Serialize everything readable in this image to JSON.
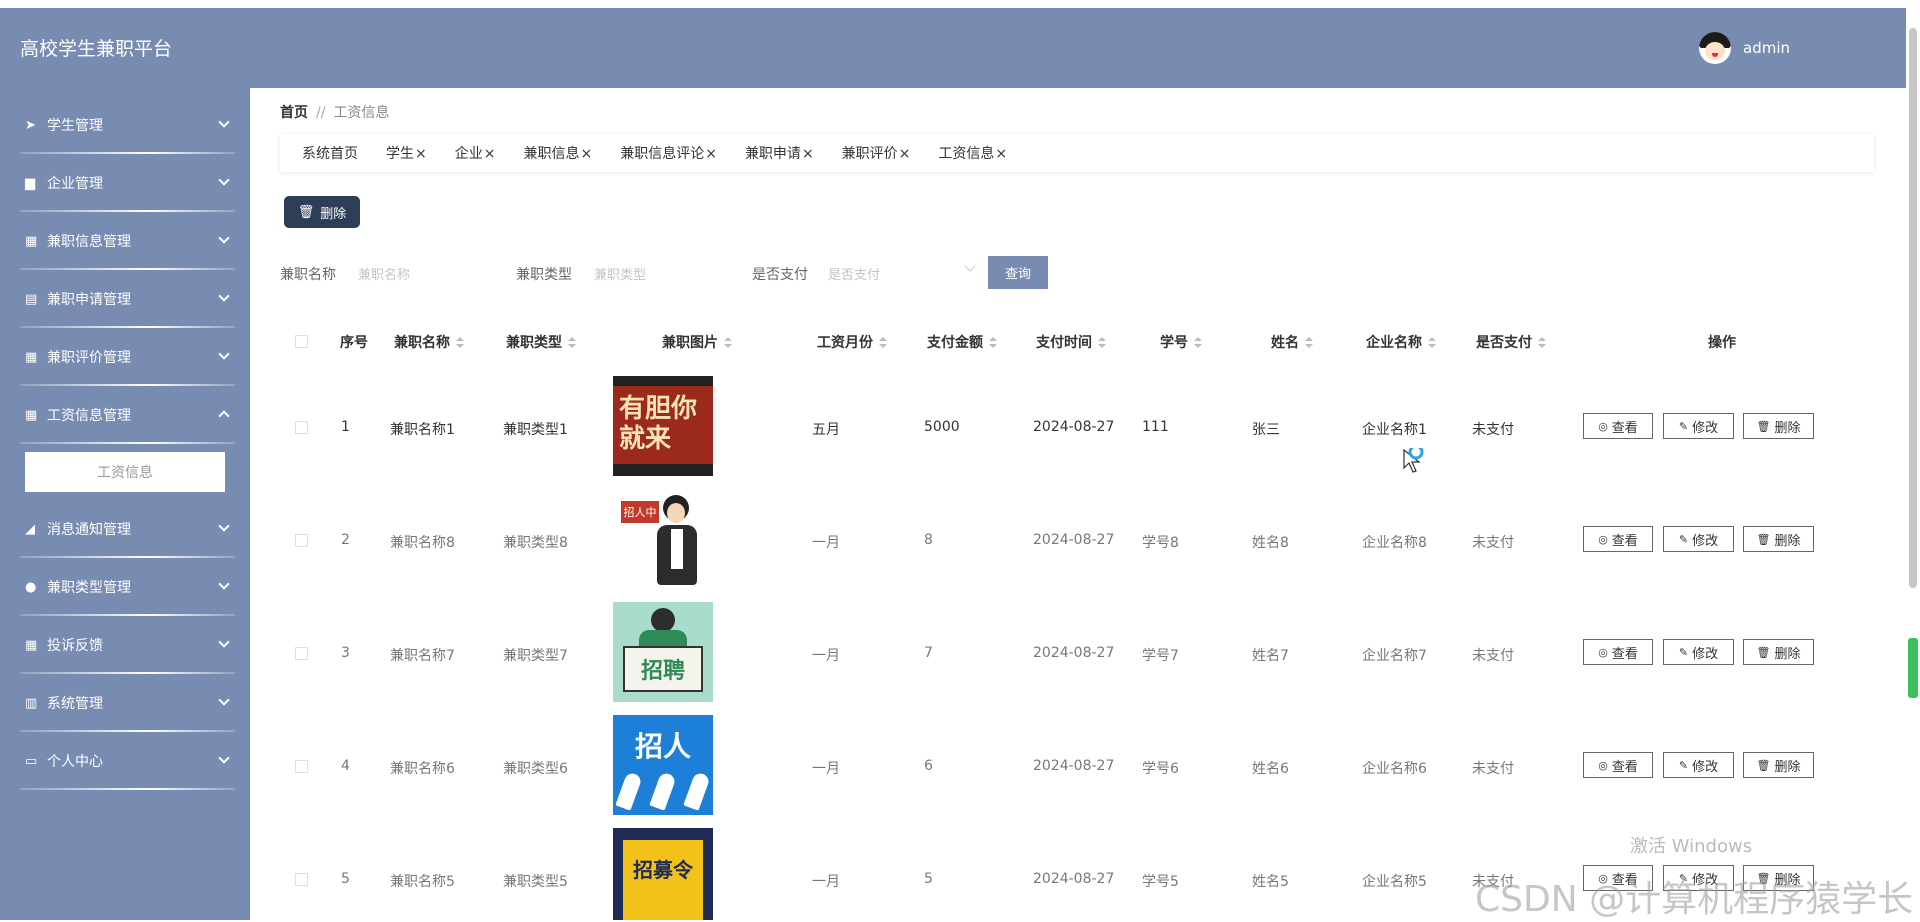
{
  "app": {
    "title": "高校学生兼职平台",
    "username": "admin"
  },
  "sidebar": {
    "items": [
      {
        "label": "学生管理",
        "icon": "send-icon"
      },
      {
        "label": "企业管理",
        "icon": "briefcase-icon"
      },
      {
        "label": "兼职信息管理",
        "icon": "grid-icon"
      },
      {
        "label": "兼职申请管理",
        "icon": "printer-icon"
      },
      {
        "label": "兼职评价管理",
        "icon": "grid-icon"
      },
      {
        "label": "工资信息管理",
        "icon": "grid-icon",
        "expanded": true
      },
      {
        "label": "消息通知管理",
        "icon": "chart-icon"
      },
      {
        "label": "兼职类型管理",
        "icon": "user-icon"
      },
      {
        "label": "投诉反馈",
        "icon": "grid-icon"
      },
      {
        "label": "系统管理",
        "icon": "books-icon"
      },
      {
        "label": "个人中心",
        "icon": "card-icon"
      }
    ],
    "submenu": "工资信息"
  },
  "breadcrumb": {
    "home": "首页",
    "separator": "//",
    "current": "工资信息"
  },
  "tags": [
    "系统首页",
    "学生",
    "企业",
    "兼职信息",
    "兼职信息评论",
    "兼职申请",
    "兼职评价",
    "工资信息"
  ],
  "tag_close": "×",
  "toolbar": {
    "delete_label": "删除"
  },
  "filters": {
    "name_label": "兼职名称",
    "name_placeholder": "兼职名称",
    "type_label": "兼职类型",
    "type_placeholder": "兼职类型",
    "paid_label": "是否支付",
    "paid_placeholder": "是否支付",
    "query_label": "查询"
  },
  "table": {
    "columns": [
      "序号",
      "兼职名称",
      "兼职类型",
      "兼职图片",
      "工资月份",
      "支付金额",
      "支付时间",
      "学号",
      "姓名",
      "企业名称",
      "是否支付",
      "操作"
    ],
    "actions": {
      "view": "查看",
      "edit": "修改",
      "delete": "删除"
    },
    "rows": [
      {
        "no": "1",
        "name": "兼职名称1",
        "type": "兼职类型1",
        "month": "五月",
        "amount": "5000",
        "time": "2024-08-27",
        "sid": "111",
        "sname": "张三",
        "company": "企业名称1",
        "paid": "未支付",
        "img_text": "有胆你就来"
      },
      {
        "no": "2",
        "name": "兼职名称8",
        "type": "兼职类型8",
        "month": "一月",
        "amount": "8",
        "time": "2024-08-27",
        "sid": "学号8",
        "sname": "姓名8",
        "company": "企业名称8",
        "paid": "未支付",
        "img_text": "招人中"
      },
      {
        "no": "3",
        "name": "兼职名称7",
        "type": "兼职类型7",
        "month": "一月",
        "amount": "7",
        "time": "2024-08-27",
        "sid": "学号7",
        "sname": "姓名7",
        "company": "企业名称7",
        "paid": "未支付",
        "img_text": "招聘"
      },
      {
        "no": "4",
        "name": "兼职名称6",
        "type": "兼职类型6",
        "month": "一月",
        "amount": "6",
        "time": "2024-08-27",
        "sid": "学号6",
        "sname": "姓名6",
        "company": "企业名称6",
        "paid": "未支付",
        "img_text": "招人"
      },
      {
        "no": "5",
        "name": "兼职名称5",
        "type": "兼职类型5",
        "month": "一月",
        "amount": "5",
        "time": "2024-08-27",
        "sid": "学号5",
        "sname": "姓名5",
        "company": "企业名称5",
        "paid": "未支付",
        "img_text": "招募令"
      }
    ]
  },
  "watermarks": {
    "os": "激活 Windows",
    "csdn": "CSDN @计算机程序猿学长"
  },
  "colors": {
    "header": "#788bb1",
    "sidebar": "#788bb1",
    "dark_button": "#2d3e57",
    "query_button": "#788bb1"
  }
}
